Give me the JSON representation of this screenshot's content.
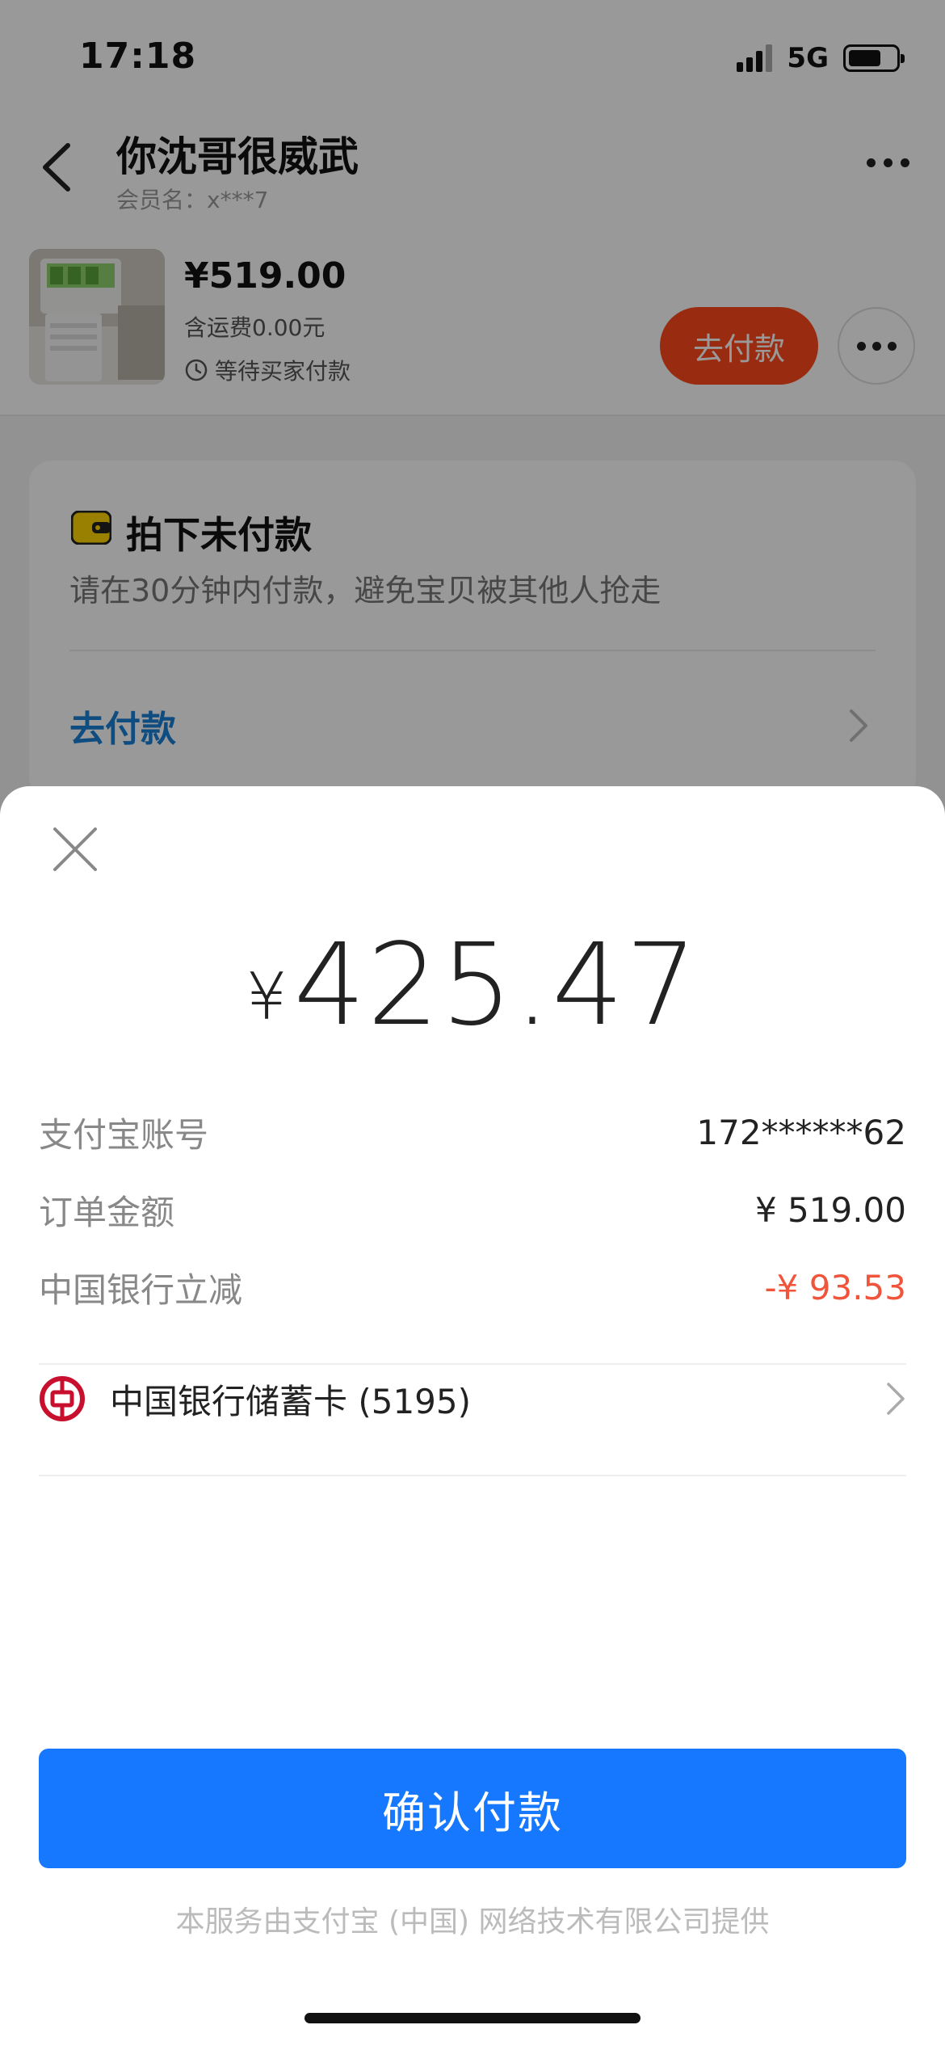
{
  "status_bar": {
    "time": "17:18",
    "network": "5G",
    "battery_level": 0.7
  },
  "header": {
    "title": "你沈哥很威武",
    "member_name": "会员名：x***7"
  },
  "product": {
    "price": "¥519.00",
    "shipping": "含运费0.00元",
    "status": "等待买家付款",
    "pay_button": "去付款"
  },
  "order_card": {
    "title": "拍下未付款",
    "tip": "请在30分钟内付款，避免宝贝被其他人抢走",
    "link": "去付款"
  },
  "payment_sheet": {
    "currency_symbol": "¥",
    "amount": "425.47",
    "details": [
      {
        "label": "支付宝账号",
        "value": "172******62"
      },
      {
        "label": "订单金额",
        "value": "¥ 519.00"
      },
      {
        "label": "中国银行立减",
        "value": "-¥ 93.53"
      }
    ],
    "payment_method": "中国银行储蓄卡 (5195)",
    "confirm_button": "确认付款",
    "provider_note": "本服务由支付宝 (中国) 网络技术有限公司提供"
  },
  "colors": {
    "confirm_blue": "#1677ff",
    "discount_red": "#f0553c",
    "pay_orange": "#ff4a1c",
    "link_blue": "#1a7fd6",
    "boc_red": "#c8102e"
  },
  "icons": [
    "back-icon",
    "more-icon",
    "clock-icon",
    "wallet-icon",
    "chevron-right-icon",
    "close-icon",
    "bank-of-china-icon"
  ]
}
